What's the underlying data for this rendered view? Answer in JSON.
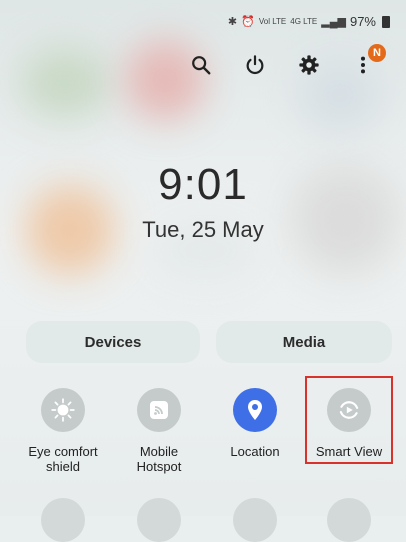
{
  "status_bar": {
    "icons": [
      "bluetooth-icon",
      "alarm-icon",
      "volte-icon",
      "4g-lte-icon",
      "signal-icon"
    ],
    "battery_percent": "97%"
  },
  "top_actions": {
    "search_icon": "search-icon",
    "power_icon": "power-icon",
    "settings_icon": "gear-icon",
    "more_icon": "more-vert-icon",
    "notification_badge": "N",
    "badge_color": "#e46a1b"
  },
  "lockscreen": {
    "time": "9:01",
    "date": "Tue, 25 May"
  },
  "panels": {
    "devices_label": "Devices",
    "media_label": "Media"
  },
  "quick_tiles": [
    {
      "label_line1": "Eye comfort",
      "label_line2": "shield",
      "icon": "eye-comfort-icon",
      "active": false
    },
    {
      "label_line1": "Mobile",
      "label_line2": "Hotspot",
      "icon": "hotspot-icon",
      "active": false
    },
    {
      "label_line1": "Location",
      "label_line2": "",
      "icon": "location-pin-icon",
      "active": true
    },
    {
      "label_line1": "Smart View",
      "label_line2": "",
      "icon": "smart-view-icon",
      "active": false
    }
  ],
  "colors": {
    "active_tile": "#3f6fe6",
    "inactive_tile": "#c5cbcb",
    "highlight": "#d8322a"
  }
}
